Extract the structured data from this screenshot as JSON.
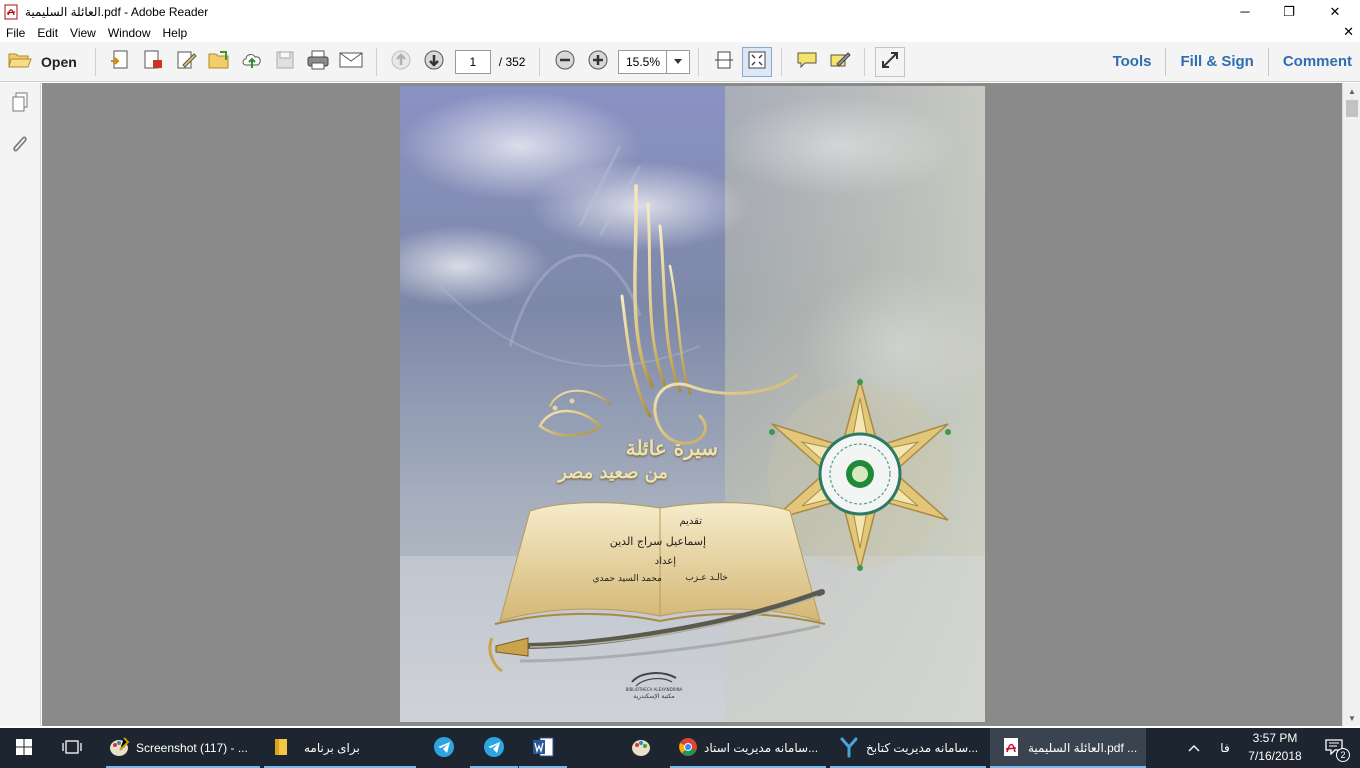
{
  "window": {
    "title": "العائلة السليمية.pdf - Adobe Reader",
    "app_icon": "pdf-icon",
    "controls": {
      "minimize": "─",
      "maximize": "❐",
      "close": "✕"
    }
  },
  "menubar": {
    "items": [
      "File",
      "Edit",
      "View",
      "Window",
      "Help"
    ],
    "close_doc": "✕"
  },
  "toolbar": {
    "open_label": "Open",
    "page_current": "1",
    "page_total": "/ 352",
    "zoom": "15.5%",
    "panels": [
      "Tools",
      "Fill & Sign",
      "Comment"
    ],
    "accent": "#2f6db1"
  },
  "cover": {
    "title_calligraphy": "العائلة السليمية",
    "subtitle_line1": "سيرة عائلة",
    "subtitle_line2": "من صعيد مصر",
    "preface_label": "تقديم",
    "preface_author": "إسماعيل سراج الدين",
    "prepared_label": "إعداد",
    "author1": "خالـد عـزب",
    "author2": "محمد السيد حمدي",
    "publisher_latin": "BIBLIOTHECA ALEXANDRINA",
    "publisher_ar": "مكتبة الإسكندرية"
  },
  "taskbar": {
    "items": [
      {
        "label": "Screenshot (117) - ...",
        "icon": "paint-icon"
      },
      {
        "label": "برای برنامه",
        "icon": "folder-icon"
      },
      {
        "label": "",
        "icon": "telegram-icon"
      },
      {
        "label": "",
        "icon": "telegram-icon"
      },
      {
        "label": "",
        "icon": "word-icon"
      },
      {
        "label": "",
        "icon": "paint-icon"
      },
      {
        "label": "سامانه مديريت استاد...",
        "icon": "chrome-icon"
      },
      {
        "label": "سامانه مدیریت کتابخ...",
        "icon": "app-icon"
      },
      {
        "label": "العائلة السليمية.pdf ...",
        "icon": "pdf-icon"
      }
    ],
    "lang": "فا",
    "time": "3:57 PM",
    "date": "7/16/2018",
    "notifications": "2"
  }
}
